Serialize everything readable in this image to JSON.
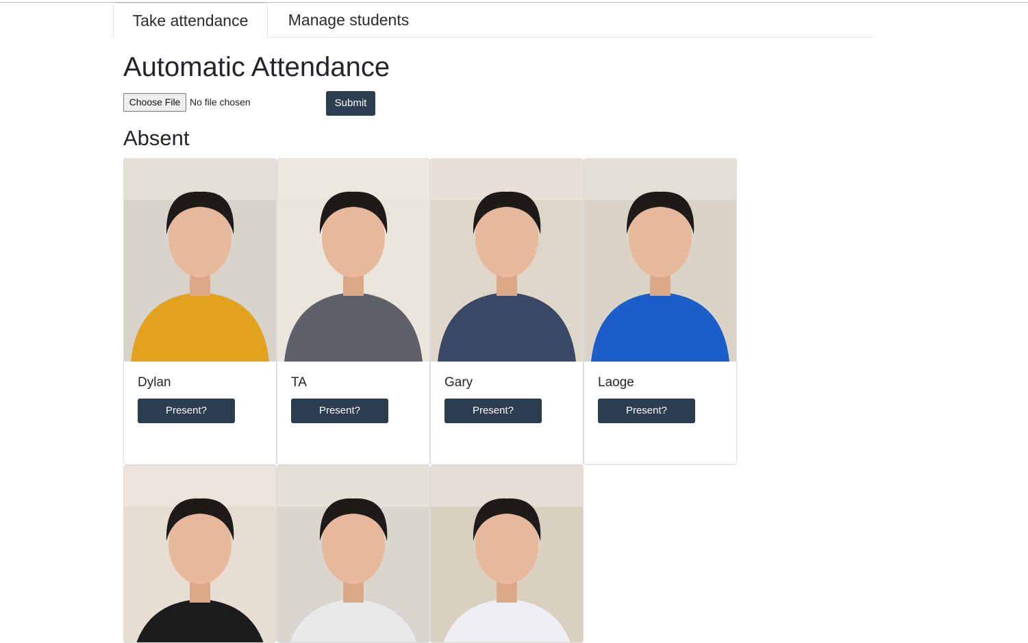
{
  "tabs": [
    {
      "label": "Take attendance",
      "active": true
    },
    {
      "label": "Manage students",
      "active": false
    }
  ],
  "page_title": "Automatic Attendance",
  "upload": {
    "choose_label": "Choose File",
    "status": "No file chosen",
    "submit_label": "Submit"
  },
  "section_title": "Absent",
  "students": [
    {
      "name": "Dylan",
      "button": "Present?",
      "shirt": "#e2a21c",
      "bg": "#d8d3cc"
    },
    {
      "name": "TA",
      "button": "Present?",
      "shirt": "#5f6168",
      "bg": "#ebe6dd"
    },
    {
      "name": "Gary",
      "button": "Present?",
      "shirt": "#3a4866",
      "bg": "#ded6c8"
    },
    {
      "name": "Laoge",
      "button": "Present?",
      "shirt": "#1a5fc8",
      "bg": "#dad4c8"
    },
    {
      "name": "",
      "button": "",
      "shirt": "#1c1c1e",
      "bg": "#e6ded2"
    },
    {
      "name": "",
      "button": "",
      "shirt": "#e9e9ec",
      "bg": "#d9d6cf"
    },
    {
      "name": "",
      "button": "",
      "shirt": "#eeeef3",
      "bg": "#d9d0c2"
    }
  ],
  "colors": {
    "button_bg": "#2c3e50",
    "card_border": "#dcdcdc"
  }
}
